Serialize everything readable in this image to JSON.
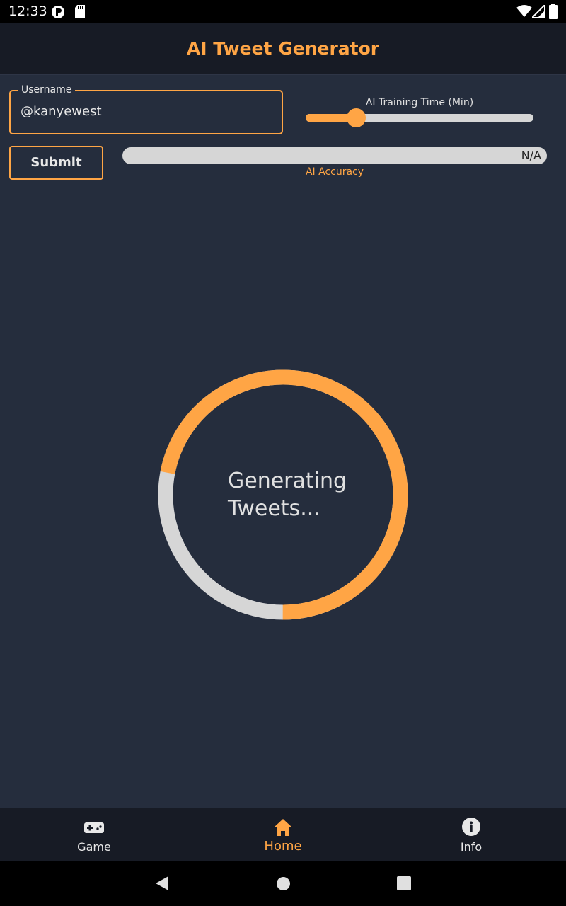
{
  "status_bar": {
    "time": "12:33",
    "icons": [
      "notification-p-icon",
      "sd-card-icon",
      "wifi-icon",
      "signal-icon",
      "battery-icon"
    ]
  },
  "app_bar": {
    "title": "AI Tweet Generator"
  },
  "form": {
    "username_label": "Username",
    "username_value": "@kanyewest",
    "training_label": "AI Training Time (Min)",
    "training_level": 0.22,
    "submit_label": "Submit",
    "accuracy_value": "N/A",
    "accuracy_label": "AI Accuracy"
  },
  "progress": {
    "text_line1": "Generating",
    "text_line2": "Tweets...",
    "fraction": 0.72
  },
  "bottom_nav": {
    "items": [
      {
        "label": "Game",
        "icon": "gamepad-icon",
        "active": false
      },
      {
        "label": "Home",
        "icon": "home-icon",
        "active": true
      },
      {
        "label": "Info",
        "icon": "info-icon",
        "active": false
      }
    ]
  },
  "system_nav": {
    "icons": [
      "back-icon",
      "home-circle-icon",
      "recents-icon"
    ]
  },
  "colors": {
    "accent": "#ffa545",
    "background": "#252d3d",
    "bar": "#171b25",
    "track": "#d6d6d6"
  }
}
